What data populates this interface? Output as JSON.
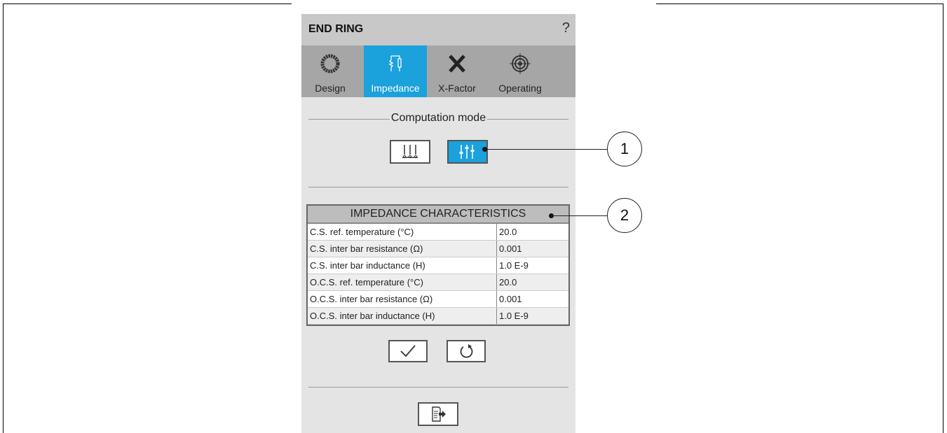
{
  "window": {
    "title": "END RING",
    "help": "?"
  },
  "tabs": [
    {
      "label": "Design",
      "icon": "ring-icon",
      "active": false
    },
    {
      "label": "Impedance",
      "icon": "impedance-icon",
      "active": true
    },
    {
      "label": "X-Factor",
      "icon": "x-factor-icon",
      "active": false
    },
    {
      "label": "Operating",
      "icon": "target-icon",
      "active": false
    }
  ],
  "computation_mode": {
    "title": "Computation mode",
    "buttons": [
      {
        "icon": "fixed-probes-icon",
        "active": false
      },
      {
        "icon": "sliders-icon",
        "active": true
      }
    ]
  },
  "impedance": {
    "title": "IMPEDANCE CHARACTERISTICS",
    "rows": [
      {
        "label": "C.S. ref. temperature (°C)",
        "value": "20.0"
      },
      {
        "label": "C.S. inter bar resistance (Ω)",
        "value": "0.001"
      },
      {
        "label": "C.S. inter bar inductance (H)",
        "value": "1.0 E-9"
      },
      {
        "label": "O.C.S. ref. temperature (°C)",
        "value": "20.0"
      },
      {
        "label": "O.C.S. inter bar resistance (Ω)",
        "value": "0.001"
      },
      {
        "label": "O.C.S. inter bar inductance (H)",
        "value": "1.0 E-9"
      }
    ]
  },
  "actions": {
    "apply_icon": "check-icon",
    "reset_icon": "reset-icon",
    "export_icon": "export-icon"
  },
  "callouts": [
    "1",
    "2"
  ],
  "colors": {
    "accent": "#1ba1dc",
    "panel": "#e4e4e4",
    "tabbar": "#a6a6a6",
    "titlebar": "#c8c8c8"
  }
}
